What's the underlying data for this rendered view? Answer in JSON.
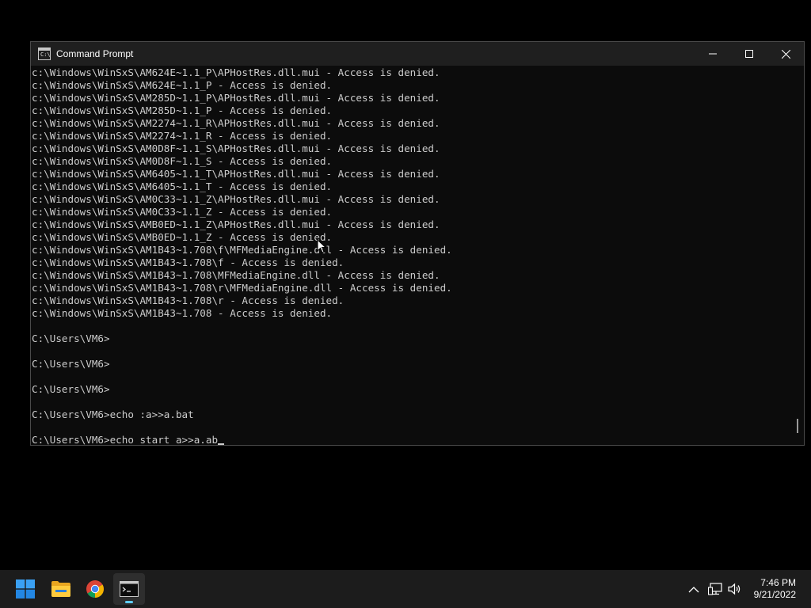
{
  "window": {
    "title": "Command Prompt",
    "icon": "cmd-icon",
    "icon_text": "C:\\"
  },
  "console": {
    "lines": [
      "c:\\Windows\\WinSxS\\AM624E~1.1_P\\APHostRes.dll.mui - Access is denied.",
      "c:\\Windows\\WinSxS\\AM624E~1.1_P - Access is denied.",
      "c:\\Windows\\WinSxS\\AM285D~1.1_P\\APHostRes.dll.mui - Access is denied.",
      "c:\\Windows\\WinSxS\\AM285D~1.1_P - Access is denied.",
      "c:\\Windows\\WinSxS\\AM2274~1.1_R\\APHostRes.dll.mui - Access is denied.",
      "c:\\Windows\\WinSxS\\AM2274~1.1_R - Access is denied.",
      "c:\\Windows\\WinSxS\\AM0D8F~1.1_S\\APHostRes.dll.mui - Access is denied.",
      "c:\\Windows\\WinSxS\\AM0D8F~1.1_S - Access is denied.",
      "c:\\Windows\\WinSxS\\AM6405~1.1_T\\APHostRes.dll.mui - Access is denied.",
      "c:\\Windows\\WinSxS\\AM6405~1.1_T - Access is denied.",
      "c:\\Windows\\WinSxS\\AM0C33~1.1_Z\\APHostRes.dll.mui - Access is denied.",
      "c:\\Windows\\WinSxS\\AM0C33~1.1_Z - Access is denied.",
      "c:\\Windows\\WinSxS\\AMB0ED~1.1_Z\\APHostRes.dll.mui - Access is denied.",
      "c:\\Windows\\WinSxS\\AMB0ED~1.1_Z - Access is denied.",
      "c:\\Windows\\WinSxS\\AM1B43~1.708\\f\\MFMediaEngine.dll - Access is denied.",
      "c:\\Windows\\WinSxS\\AM1B43~1.708\\f - Access is denied.",
      "c:\\Windows\\WinSxS\\AM1B43~1.708\\MFMediaEngine.dll - Access is denied.",
      "c:\\Windows\\WinSxS\\AM1B43~1.708\\r\\MFMediaEngine.dll - Access is denied.",
      "c:\\Windows\\WinSxS\\AM1B43~1.708\\r - Access is denied.",
      "c:\\Windows\\WinSxS\\AM1B43~1.708 - Access is denied.",
      "",
      "C:\\Users\\VM6>",
      "",
      "C:\\Users\\VM6>",
      "",
      "C:\\Users\\VM6>",
      "",
      "C:\\Users\\VM6>echo :a>>a.bat",
      ""
    ],
    "current_line": "C:\\Users\\VM6>echo start a>>a.ab"
  },
  "taskbar": {
    "items": [
      {
        "name": "start-button",
        "icon": "windows-logo-icon"
      },
      {
        "name": "file-explorer",
        "icon": "folder-icon"
      },
      {
        "name": "chrome",
        "icon": "chrome-icon"
      },
      {
        "name": "command-prompt",
        "icon": "cmd-icon",
        "active": true
      }
    ],
    "tray": {
      "chevron": "chevron-up-icon",
      "network": "network-icon",
      "volume": "volume-icon"
    },
    "time": "7:46 PM",
    "date": "9/21/2022"
  },
  "colors": {
    "console_bg": "#0c0c0c",
    "console_text": "#cccccc",
    "titlebar_bg": "#1f1f1f",
    "taskbar_bg": "#1c1c1c",
    "accent": "#60cdff"
  }
}
